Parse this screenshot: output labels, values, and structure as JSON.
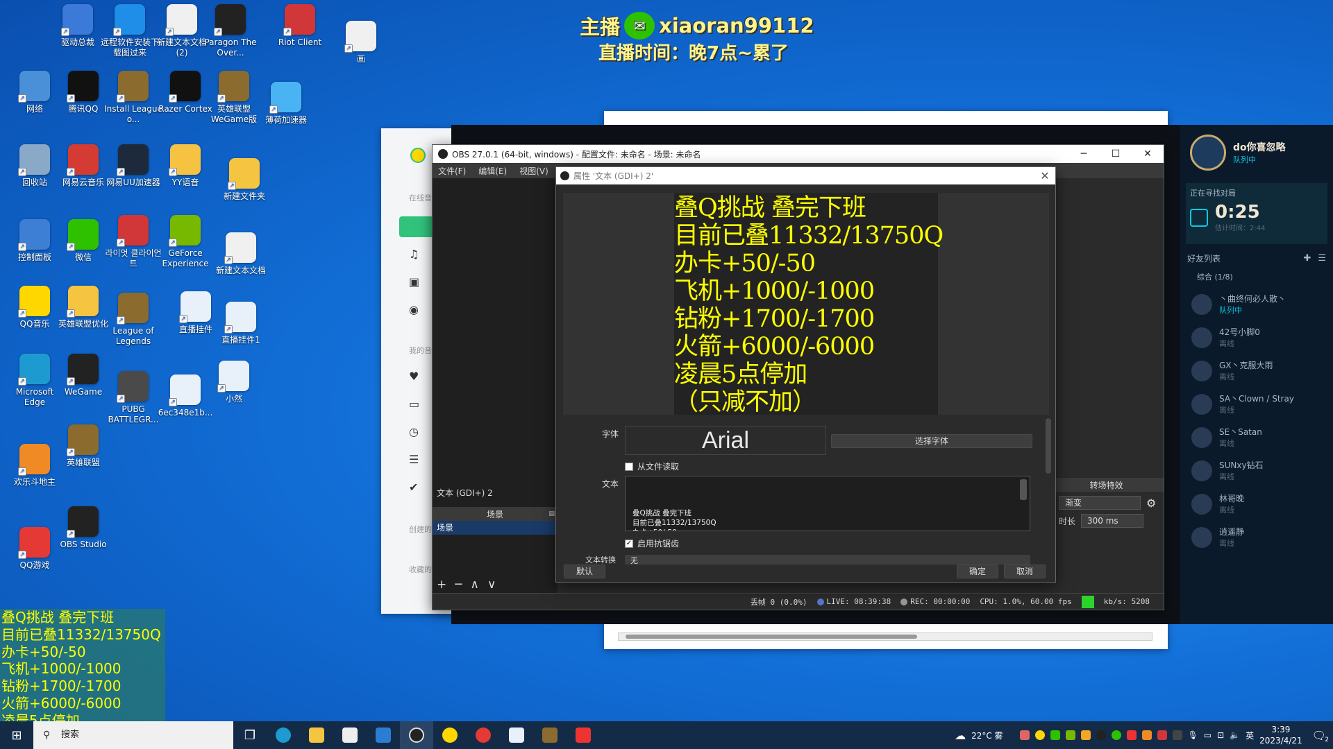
{
  "colors": {
    "desktop_bg": "#1270d8",
    "overlay_yellow": "#ffff00",
    "obs_dark": "#2b2b2b",
    "obs_scene_selected": "#1a3a68",
    "live_green": "#2bd42b",
    "music_accent": "#31c27c"
  },
  "desktop": {
    "icons": [
      {
        "label": "驱动总裁",
        "icon": "driver-icon",
        "color": "#3b7ad9"
      },
      {
        "label": "远程软件安装下载图过来",
        "icon": "remote-desktop-icon",
        "color": "#1e8ee8"
      },
      {
        "label": "新建文本文档 (2)",
        "icon": "text-file-icon",
        "color": "#f0f0f0"
      },
      {
        "label": "Paragon The Over...",
        "icon": "paragon-icon",
        "color": "#222222"
      },
      {
        "label": "Riot Client",
        "icon": "riot-client-icon",
        "color": "#d13639"
      },
      {
        "label": "画",
        "icon": "file-icon",
        "color": "#f0f0f0"
      },
      {
        "label": "网络",
        "icon": "network-icon",
        "color": "#4a90d9"
      },
      {
        "label": "腾讯QQ",
        "icon": "qq-icon",
        "color": "#111111"
      },
      {
        "label": "Install League o...",
        "icon": "league-install-icon",
        "color": "#8b6b2e"
      },
      {
        "label": "Razer Cortex",
        "icon": "razer-icon",
        "color": "#111111"
      },
      {
        "label": "英雄联盟WeGame版",
        "icon": "league-wegame-icon",
        "color": "#8b6b2e"
      },
      {
        "label": "薄荷加速器",
        "icon": "accelerator-icon",
        "color": "#4ab3f4"
      },
      {
        "label": "回收站",
        "icon": "recycle-bin-icon",
        "color": "#8aa8c8"
      },
      {
        "label": "网易云音乐",
        "icon": "netease-music-icon",
        "color": "#d43c33"
      },
      {
        "label": "网易UU加速器",
        "icon": "uu-accelerator-icon",
        "color": "#1c2a3c"
      },
      {
        "label": "YY语音",
        "icon": "yy-voice-icon",
        "color": "#f5c242"
      },
      {
        "label": "新建文件夹",
        "icon": "folder-icon",
        "color": "#f5c542"
      },
      {
        "label": "控制面板",
        "icon": "control-panel-icon",
        "color": "#3c7fd4"
      },
      {
        "label": "微信",
        "icon": "wechat-icon",
        "color": "#2dc100"
      },
      {
        "label": "라이엇 클라이언트",
        "icon": "riot-client-kr-icon",
        "color": "#d13639"
      },
      {
        "label": "GeForce Experience",
        "icon": "geforce-icon",
        "color": "#76b900"
      },
      {
        "label": "新建文本文档",
        "icon": "text-file-icon",
        "color": "#f0f0f0"
      },
      {
        "label": "QQ音乐",
        "icon": "qq-music-icon",
        "color": "#ffd700"
      },
      {
        "label": "英雄联盟优化",
        "icon": "folder-icon",
        "color": "#f5c542"
      },
      {
        "label": "League of Legends",
        "icon": "league-icon",
        "color": "#8b6b2e"
      },
      {
        "label": "直播挂件",
        "icon": "image-file-icon",
        "color": "#e8f0fa"
      },
      {
        "label": "直播挂件1",
        "icon": "image-file-icon",
        "color": "#e8f0fa"
      },
      {
        "label": "Microsoft Edge",
        "icon": "edge-icon",
        "color": "#1d9bd1"
      },
      {
        "label": "WeGame",
        "icon": "wegame-icon",
        "color": "#222222"
      },
      {
        "label": "PUBG BATTLEGR...",
        "icon": "pubg-icon",
        "color": "#4a4a4a"
      },
      {
        "label": "6ec348e1b...",
        "icon": "image-file-icon",
        "color": "#e8f0fa"
      },
      {
        "label": "小然",
        "icon": "image-file-icon",
        "color": "#e8f0fa"
      },
      {
        "label": "欢乐斗地主",
        "icon": "doudizhu-icon",
        "color": "#f08a24"
      },
      {
        "label": "英雄联盟",
        "icon": "league-icon",
        "color": "#8b6b2e"
      },
      {
        "label": "OBS Studio",
        "icon": "obs-icon",
        "color": "#222222"
      },
      {
        "label": "QQ游戏",
        "icon": "qq-game-icon",
        "color": "#e53935"
      }
    ]
  },
  "stream_overlay": {
    "host_label": "主播",
    "host_id": "xiaoran99112",
    "airtime": "直播时间：晚7点~累了"
  },
  "music_app": {
    "section_online": "在线音",
    "section_my": "我的音",
    "section_created": "创建的",
    "section_collected": "收藏的"
  },
  "lol_client": {
    "username": "do你喜忽略",
    "status": "队列中",
    "searching_label": "正在寻找对局",
    "timer": "0:25",
    "estimated": "估计时间：2:44",
    "friends_label": "好友列表",
    "group_label": "综合 (1/8)",
    "friends": [
      {
        "name": "丶曲终何必人散丶",
        "status": "队列中"
      },
      {
        "name": "42号小脚0",
        "status": "离线"
      },
      {
        "name": "GX丶克服大雨",
        "status": "离线"
      },
      {
        "name": "SA丶Clown / Stray",
        "status": "离线"
      },
      {
        "name": "SE丶Satan",
        "status": "离线"
      },
      {
        "name": "SUNxy钻石",
        "status": "离线"
      },
      {
        "name": "林哥晚",
        "status": "离线"
      },
      {
        "name": "逍遥静",
        "status": "离线"
      }
    ]
  },
  "obs": {
    "title": "OBS 27.0.1 (64-bit, windows) - 配置文件: 未命名 - 场景: 未命名",
    "menu": [
      "文件(F)",
      "编辑(E)",
      "视图(V)"
    ],
    "source_label": "文本 (GDI+) 2",
    "scenes_header": "场景",
    "scene_item": "场景",
    "transitions_header": "转场特效",
    "transition_value": "渐变",
    "duration_label": "时长",
    "duration_value": "300 ms",
    "status": {
      "dropped": "丢帧 0 (0.0%)",
      "live": "LIVE: 08:39:38",
      "rec": "REC: 00:00:00",
      "cpu": "CPU: 1.0%, 60.00 fps",
      "kbps": "kb/s: 5208"
    }
  },
  "properties": {
    "title": "属性 '文本 (GDI+) 2'",
    "preview_lines": [
      "叠Q挑战 叠完下班",
      "目前已叠11332/13750Q",
      "办卡+50/-50",
      "飞机+1000/-1000",
      "钻粉+1700/-1700",
      "火箭+6000/-6000",
      "凌晨5点停加",
      "（只减不加）"
    ],
    "font_label": "字体",
    "font_value": "Arial",
    "choose_font": "选择字体",
    "read_file_label": "从文件读取",
    "text_label": "文本",
    "text_lines": [
      "叠Q挑战 叠完下班",
      "目前已叠11332/13750Q",
      "办卡+50/-50",
      "飞机+1000/-1000",
      "钻粉+1700/-1700",
      "火箭+6000/-6000"
    ],
    "antialias_label": "启用抗锯齿",
    "wrap_label": "文本转换",
    "wrap_value": "无",
    "default_button": "默认",
    "ok_button": "确定",
    "cancel_button": "取消"
  },
  "left_overlay": {
    "lines": [
      "叠Q挑战 叠完下班",
      "目前已叠11332/13750Q",
      "办卡+50/-50",
      "飞机+1000/-1000",
      "钻粉+1700/-1700",
      "火箭+6000/-6000",
      "凌晨5点停加",
      "（只减不加）"
    ]
  },
  "taskbar": {
    "search_placeholder": "搜索",
    "weather": "22°C 雾",
    "ime": "英",
    "time": "3:39",
    "date": "2023/4/21",
    "notification_count": "2"
  }
}
